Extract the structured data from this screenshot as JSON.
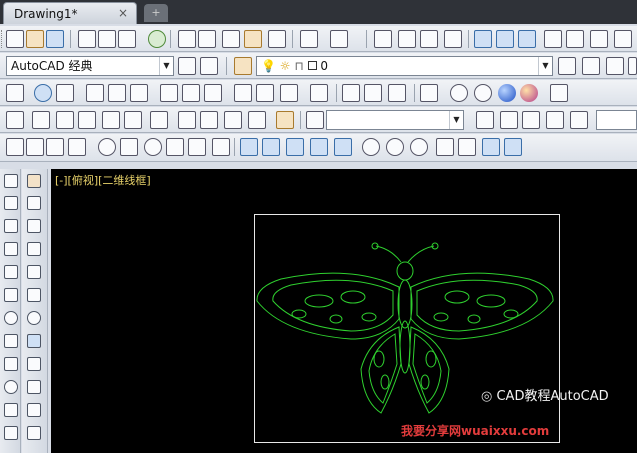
{
  "tab": {
    "title": "Drawing1*",
    "close": "×",
    "new_tab": "+"
  },
  "workspace": {
    "value": "AutoCAD 经典"
  },
  "layer": {
    "value": "0"
  },
  "viewport": {
    "label": "[-][俯视][二维线框]"
  },
  "wechat": {
    "text": "CAD教程AutoCAD"
  },
  "watermark": {
    "text": "我要分享网wuaixxu.com"
  },
  "colors": {
    "drawing_bg": "#000000",
    "butterfly": "#2fd02f",
    "label": "#e8d26a",
    "watermark": "#e23c3c"
  }
}
